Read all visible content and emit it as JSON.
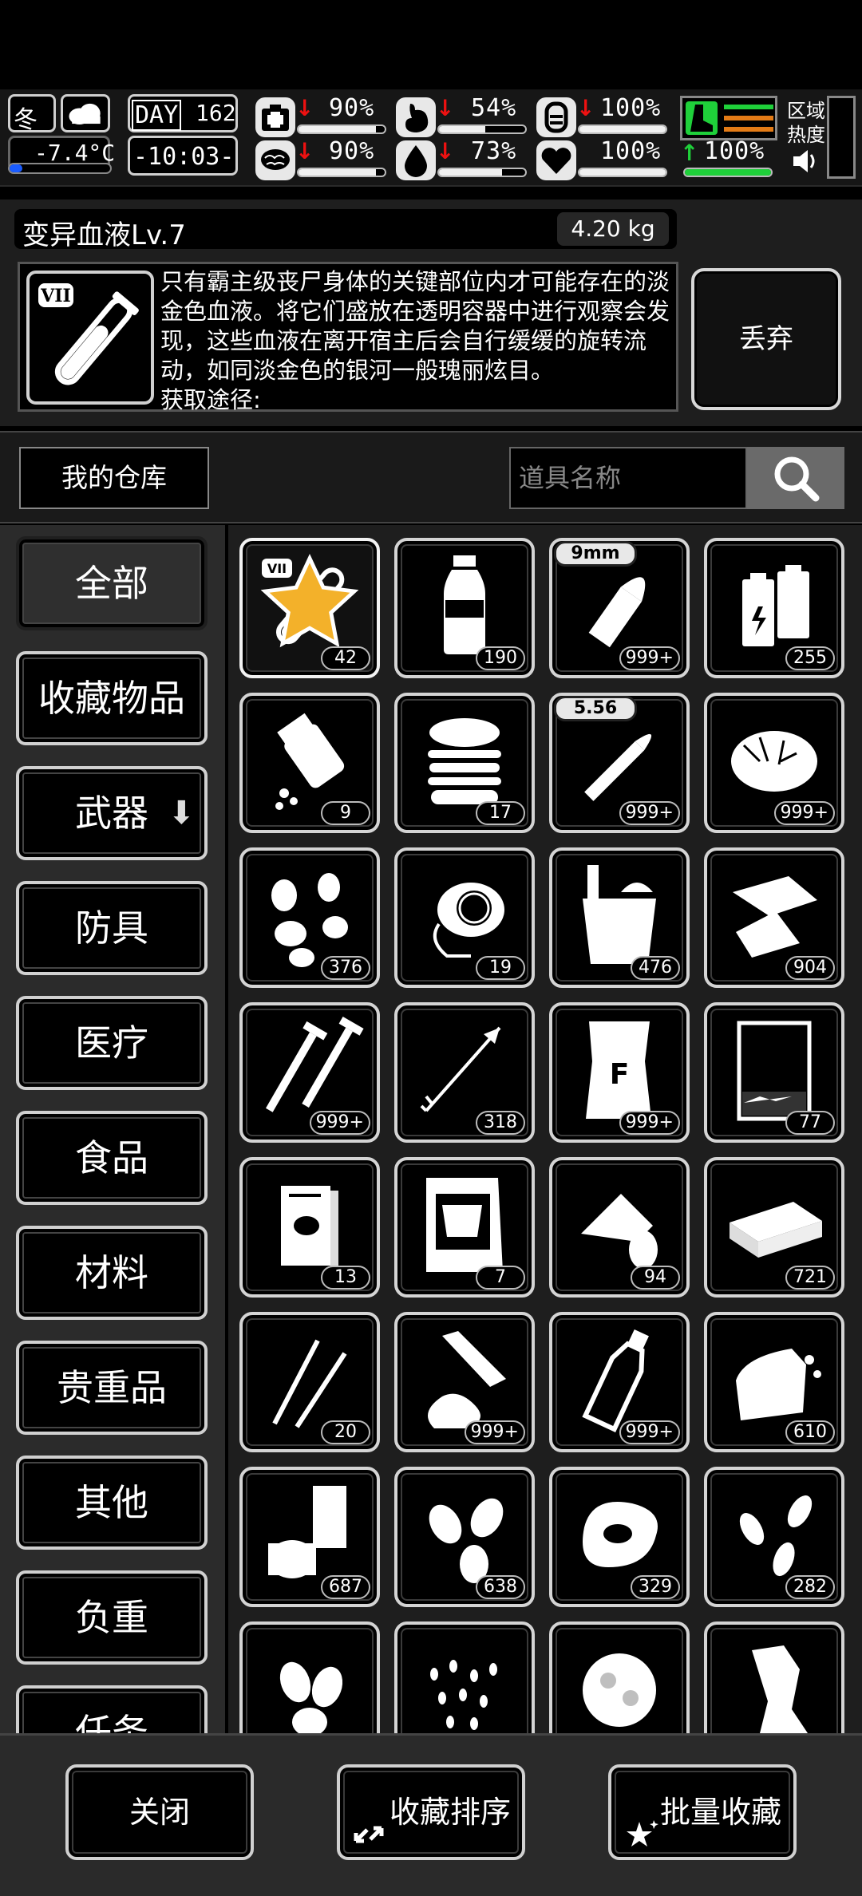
{
  "status": {
    "season": "冬",
    "weather_icon": "cloud-icon",
    "temperature": "-7.4°C",
    "day_label": "DAY",
    "day": "162",
    "time": "-10:03-",
    "region_label": "区域热度",
    "stats": [
      {
        "icon": "medkit-icon",
        "value": "90%",
        "trend": "down",
        "fill": 0.9
      },
      {
        "icon": "stomach-icon",
        "value": "54%",
        "trend": "down",
        "fill": 0.54
      },
      {
        "icon": "battery-icon",
        "value": "100%",
        "trend": "down",
        "fill": 1.0
      },
      {
        "icon": "brain-icon",
        "value": "90%",
        "trend": "down",
        "fill": 0.9
      },
      {
        "icon": "water-drop-icon",
        "value": "73%",
        "trend": "down",
        "fill": 0.73
      },
      {
        "icon": "heart-icon",
        "value": "100%",
        "trend": "none",
        "fill": 1.0
      },
      {
        "icon": "boot-icon",
        "value": "100%",
        "trend": "up",
        "fill": 1.0
      }
    ]
  },
  "detail": {
    "title": "变异血液Lv.7",
    "weight": "4.20 kg",
    "description": "只有霸主级丧尸身体的关键部位内才可能存在的淡金色血液。将它们盛放在透明容器中进行观察会发现，这些血液在离开宿主后会自行缓缓的旋转流动，如同淡金色的银河一般瑰丽炫目。\n获取途径:",
    "discard_label": "丢弃"
  },
  "search": {
    "warehouse_label": "我的仓库",
    "placeholder": "道具名称"
  },
  "categories": [
    {
      "label": "全部",
      "active": true
    },
    {
      "label": "收藏物品"
    },
    {
      "label": "武器",
      "has_arrow": true
    },
    {
      "label": "防具"
    },
    {
      "label": "医疗"
    },
    {
      "label": "食品"
    },
    {
      "label": "材料"
    },
    {
      "label": "贵重品"
    },
    {
      "label": "其他"
    },
    {
      "label": "负重"
    },
    {
      "label": "任务"
    }
  ],
  "items": [
    {
      "icon": "mutant-blood-vial-icon",
      "count": "42",
      "selected": true,
      "favorite": true
    },
    {
      "icon": "water-bottle-icon",
      "count": "190"
    },
    {
      "icon": "bullet-9mm-icon",
      "count": "999+",
      "caliber": "9mm"
    },
    {
      "icon": "batteries-icon",
      "count": "255"
    },
    {
      "icon": "pill-bottle-icon",
      "count": "9"
    },
    {
      "icon": "burger-icon",
      "count": "17"
    },
    {
      "icon": "bullet-556-icon",
      "count": "999+",
      "caliber": "5.56"
    },
    {
      "icon": "fiber-tuft-icon",
      "count": "999+"
    },
    {
      "icon": "pebbles-icon",
      "count": "376"
    },
    {
      "icon": "turbine-part-icon",
      "count": "19"
    },
    {
      "icon": "bucket-icon",
      "count": "476"
    },
    {
      "icon": "scrap-sheets-icon",
      "count": "904"
    },
    {
      "icon": "screws-icon",
      "count": "999+"
    },
    {
      "icon": "arrow-icon",
      "count": "318"
    },
    {
      "icon": "fertilizer-bag-icon",
      "count": "999+"
    },
    {
      "icon": "beaker-icon",
      "count": "77"
    },
    {
      "icon": "book-icon",
      "count": "13"
    },
    {
      "icon": "seed-packet-icon",
      "count": "7"
    },
    {
      "icon": "bandage-roll-icon",
      "count": "94"
    },
    {
      "icon": "cash-bundle-icon",
      "count": "721"
    },
    {
      "icon": "tweezers-icon",
      "count": "20"
    },
    {
      "icon": "glue-tube-icon",
      "count": "999+"
    },
    {
      "icon": "glass-bottle-icon",
      "count": "999+"
    },
    {
      "icon": "bread-loaf-icon",
      "count": "610"
    },
    {
      "icon": "cans-icon",
      "count": "687"
    },
    {
      "icon": "nuts-icon",
      "count": "638"
    },
    {
      "icon": "raw-meat-icon",
      "count": "329"
    },
    {
      "icon": "sunflower-seeds-icon",
      "count": "282"
    },
    {
      "icon": "almonds-icon",
      "count": ""
    },
    {
      "icon": "rice-grains-icon",
      "count": ""
    },
    {
      "icon": "cauliflower-icon",
      "count": ""
    },
    {
      "icon": "herb-bundle-icon",
      "count": ""
    }
  ],
  "bottom": {
    "close_label": "关闭",
    "sort_label": "收藏排序",
    "batch_label": "批量收藏"
  }
}
